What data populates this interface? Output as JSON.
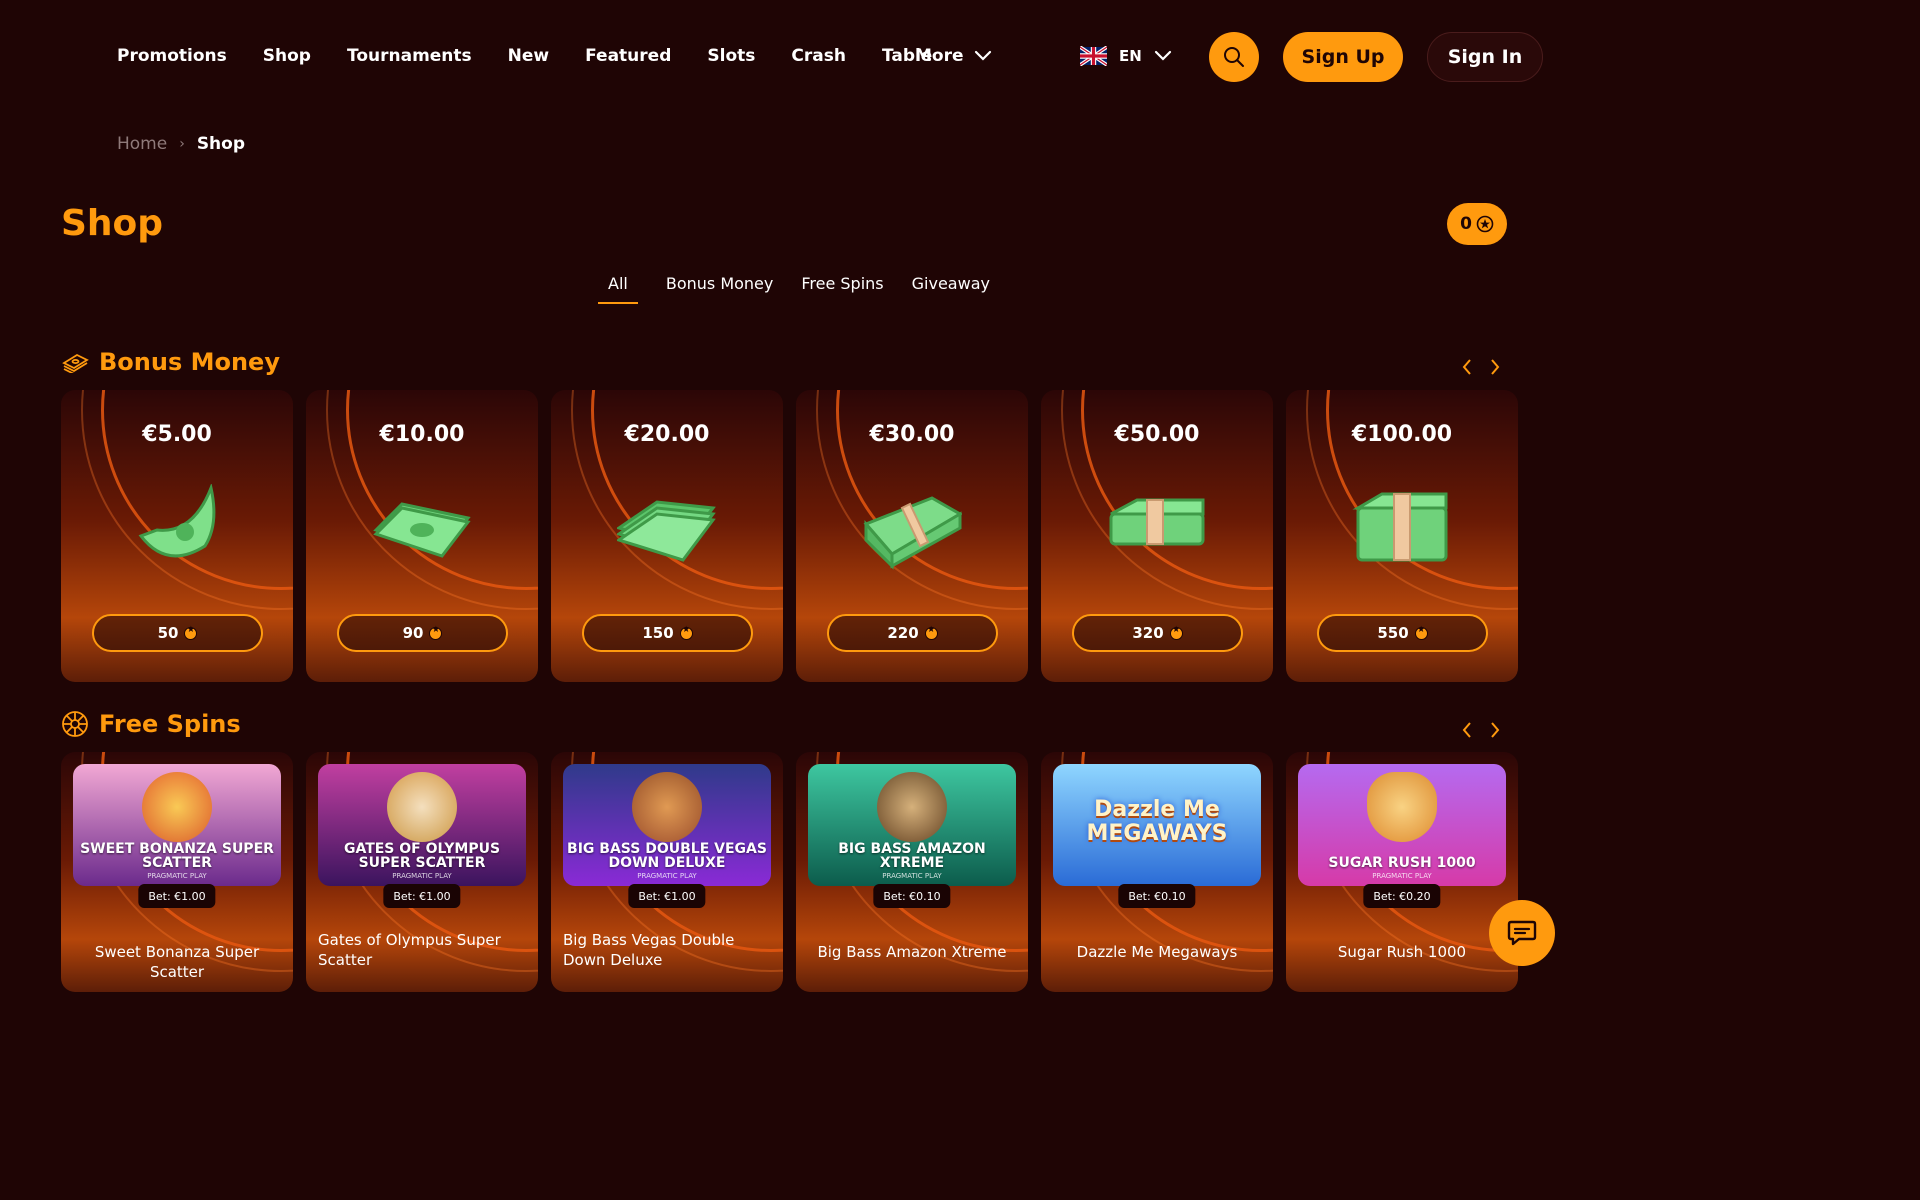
{
  "nav": {
    "links": [
      "Promotions",
      "Shop",
      "Tournaments",
      "New",
      "Featured",
      "Slots",
      "Crash",
      "Table"
    ],
    "more_label": "More",
    "language": "EN",
    "signup_label": "Sign Up",
    "signin_label": "Sign In"
  },
  "breadcrumb": {
    "home": "Home",
    "current": "Shop"
  },
  "page": {
    "title": "Shop",
    "coins": "0"
  },
  "tabs": [
    "All",
    "Bonus Money",
    "Free Spins",
    "Giveaway"
  ],
  "bonus_money": {
    "title": "Bonus Money",
    "items": [
      {
        "amount": "€5.00",
        "price": "50"
      },
      {
        "amount": "€10.00",
        "price": "90"
      },
      {
        "amount": "€20.00",
        "price": "150"
      },
      {
        "amount": "€30.00",
        "price": "220"
      },
      {
        "amount": "€50.00",
        "price": "320"
      },
      {
        "amount": "€100.00",
        "price": "550"
      }
    ]
  },
  "free_spins": {
    "title": "Free Spins",
    "items": [
      {
        "thumb_title": "SWEET BONANZA SUPER SCATTER",
        "provider": "PRAGMATIC PLAY",
        "bet": "Bet: €1.00",
        "name": "Sweet Bonanza Super Scatter",
        "thumb_colors": [
          "#f2a8d4",
          "#6b2a8c"
        ]
      },
      {
        "thumb_title": "GATES OF OLYMPUS SUPER SCATTER",
        "provider": "PRAGMATIC PLAY",
        "bet": "Bet: €1.00",
        "name": "Gates of Olympus Super Scatter",
        "thumb_colors": [
          "#c13fa0",
          "#3b145e"
        ]
      },
      {
        "thumb_title": "BIG BASS DOUBLE VEGAS DOWN DELUXE",
        "provider": "PRAGMATIC PLAY",
        "bet": "Bet: €1.00",
        "name": "Big Bass Vegas Double Down Deluxe",
        "thumb_colors": [
          "#2f3a8a",
          "#8a2ad6"
        ]
      },
      {
        "thumb_title": "BIG BASS AMAZON XTREME",
        "provider": "PRAGMATIC PLAY",
        "bet": "Bet: €0.10",
        "name": "Big Bass Amazon Xtreme",
        "thumb_colors": [
          "#3ec7a0",
          "#0c5c4c"
        ]
      },
      {
        "thumb_title": "Dazzle Me MEGAWAYS",
        "provider": "",
        "bet": "Bet: €0.10",
        "name": "Dazzle Me Megaways",
        "thumb_colors": [
          "#8fd6ff",
          "#2a6bd6"
        ]
      },
      {
        "thumb_title": "SUGAR RUSH 1000",
        "provider": "PRAGMATIC PLAY",
        "bet": "Bet: €0.20",
        "name": "Sugar Rush 1000",
        "thumb_colors": [
          "#b56af0",
          "#d63aa8"
        ]
      }
    ]
  },
  "colors": {
    "accent": "#ff9a0e",
    "background": "#1f0505"
  }
}
